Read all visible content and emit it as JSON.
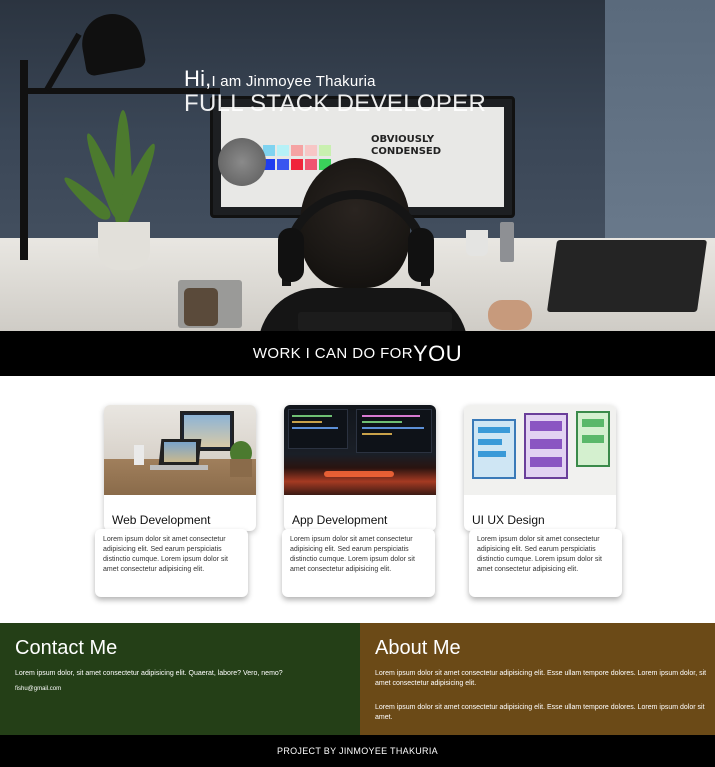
{
  "hero": {
    "greeting_hi": "Hi,",
    "greeting_name": "I am Jinmoyee Thakuria",
    "role": "FULL STACK DEVELOPER",
    "screen_headline_1": "OBVIOUSLY",
    "screen_headline_2": "CONDENSED"
  },
  "work": {
    "heading_part1": "WORK I CAN DO FOR",
    "heading_part2": "YOU"
  },
  "cards": [
    {
      "title": "Web Development",
      "description": "Lorem ipsum dolor sit amet consectetur adipisicing elit. Sed earum perspiciatis distinctio cumque. Lorem ipsum dolor sit amet consectetur adipisicing elit."
    },
    {
      "title": "App Development",
      "description": "Lorem ipsum dolor sit amet consectetur adipisicing elit. Sed earum perspiciatis distinctio cumque. Lorem ipsum dolor sit amet consectetur adipisicing elit."
    },
    {
      "title": "UI UX Design",
      "description": "Lorem ipsum dolor sit amet consectetur adipisicing elit. Sed earum perspiciatis distinctio cumque. Lorem ipsum dolor sit amet consectetur adipisicing elit."
    }
  ],
  "contact": {
    "title": "Contact Me",
    "text": "Lorem ipsum dolor, sit amet consectetur adipisicing elit. Quaerat, labore? Vero, nemo?",
    "email": "fishu@gmail.com"
  },
  "about": {
    "title": "About Me",
    "text1": "Lorem ipsum dolor sit amet consectetur adipisicing elit. Esse ullam tempore dolores. Lorem ipsum dolor, sit amet consectetur adipisicing elit.",
    "text2": "Lorem ipsum dolor sit amet consectetur adipisicing elit. Esse ullam tempore dolores. Lorem ipsum dolor sit amet."
  },
  "footer": {
    "text": "PROJECT BY JINMOYEE THAKURIA"
  },
  "colors": {
    "contact_bg": "#243f17",
    "about_bg": "#6b4a17",
    "banner_bg": "#000000"
  }
}
